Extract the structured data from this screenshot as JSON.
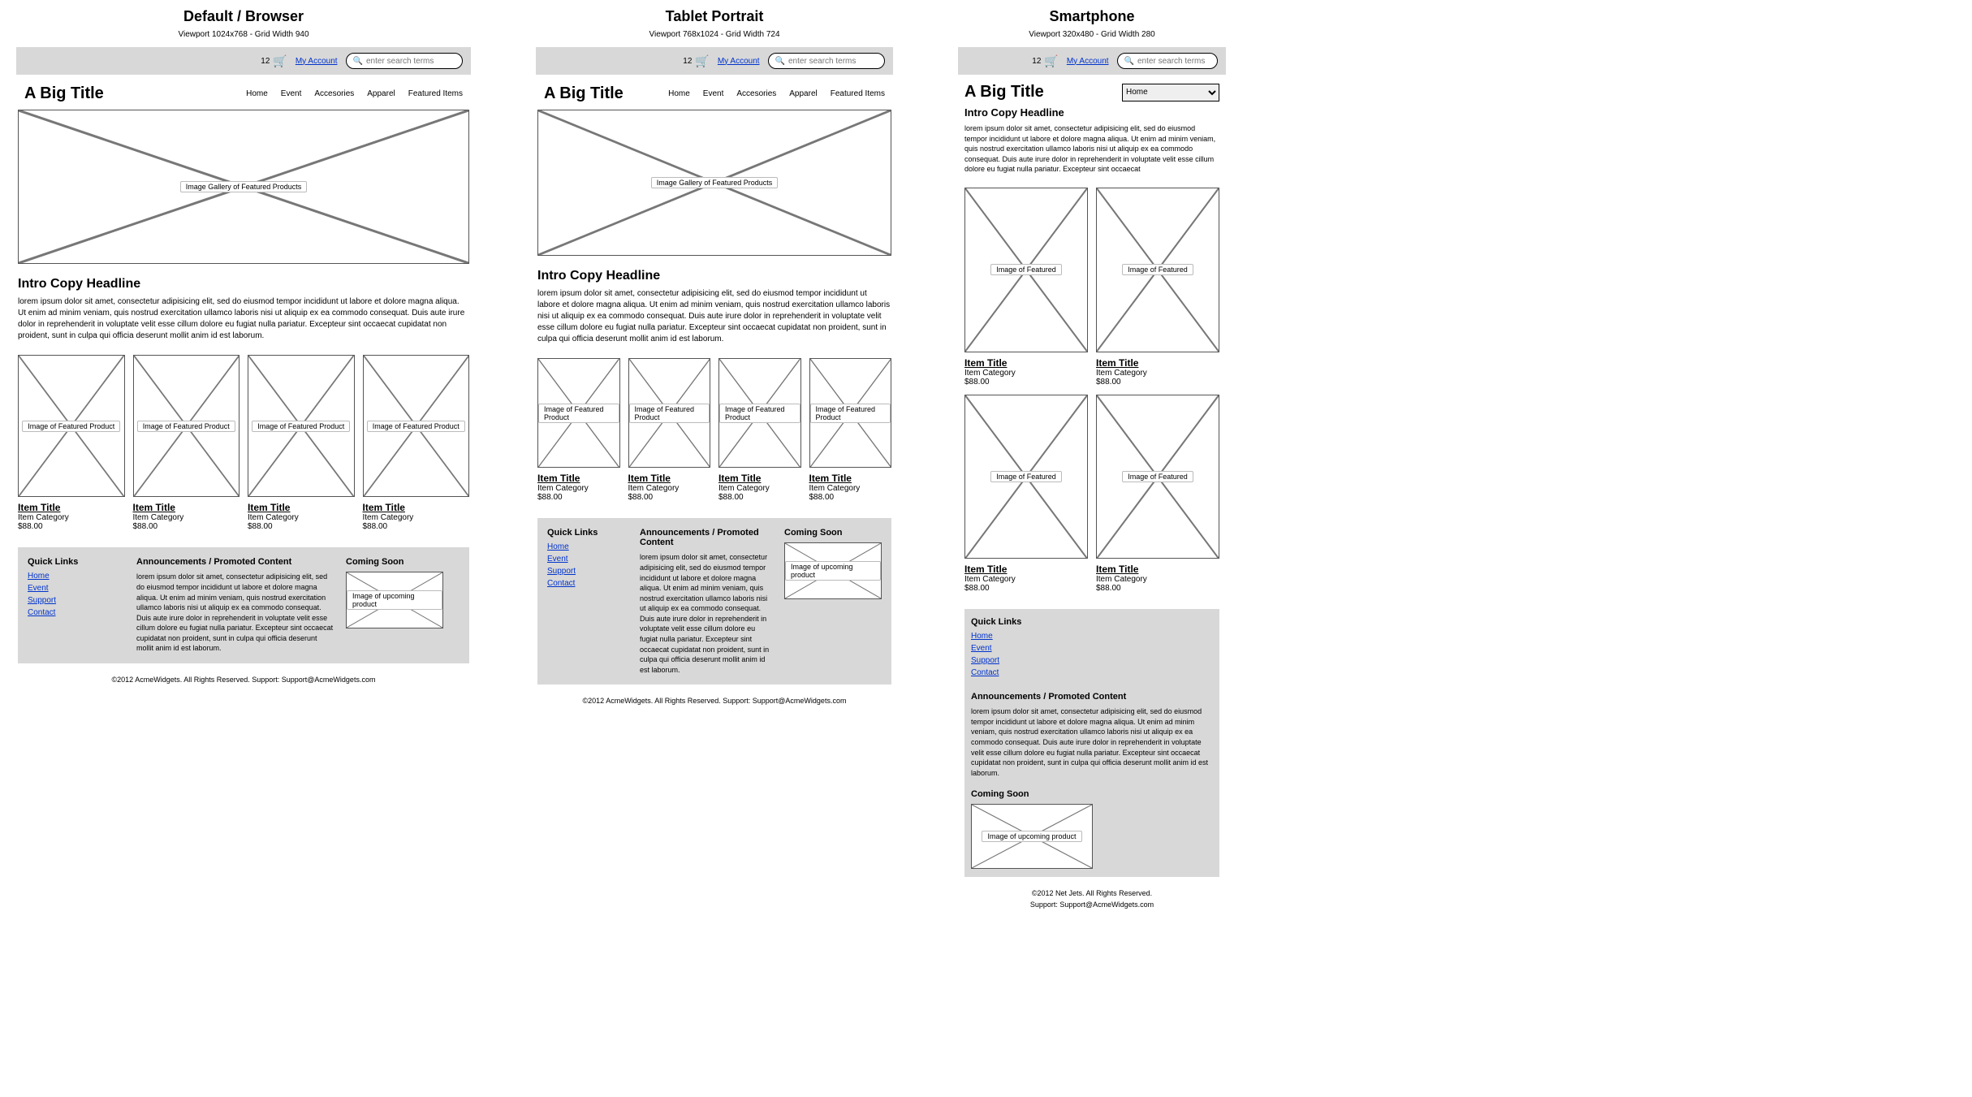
{
  "layouts": {
    "desktop": {
      "title": "Default / Browser",
      "viewport": "Viewport 1024x768 - Grid Width 940"
    },
    "tablet": {
      "title": "Tablet Portrait",
      "viewport": "Viewport 768x1024 - Grid Width 724"
    },
    "smartphone": {
      "title": "Smartphone",
      "viewport": "Viewport 320x480 - Grid Width 280"
    }
  },
  "topbar": {
    "cart_count": "12",
    "account_label": "My Account",
    "search_placeholder": "enter search terms"
  },
  "header": {
    "big_title": "A Big Title",
    "nav": [
      "Home",
      "Event",
      "Accesories",
      "Apparel",
      "Featured Items"
    ],
    "nav_selected": "Home"
  },
  "hero": {
    "label": "Image Gallery of Featured Products"
  },
  "intro": {
    "headline": "Intro Copy Headline",
    "copy_long": "lorem ipsum dolor sit amet, consectetur adipisicing elit, sed do eiusmod tempor incididunt ut labore et dolore magna aliqua. Ut enim ad minim veniam, quis nostrud exercitation ullamco laboris nisi ut aliquip ex ea commodo consequat. Duis aute irure dolor in reprehenderit in voluptate velit esse cillum dolore eu fugiat nulla pariatur. Excepteur sint occaecat cupidatat non proident, sunt in culpa qui officia deserunt mollit anim id est laborum.",
    "copy_short": "lorem ipsum dolor sit amet, consectetur adipisicing elit, sed do eiusmod tempor incididunt ut labore et dolore magna aliqua. Ut enim ad minim veniam, quis nostrud exercitation ullamco laboris nisi ut aliquip ex ea commodo consequat. Duis aute irure dolor in reprehenderit in voluptate velit esse cillum dolore eu fugiat nulla pariatur. Excepteur sint occaecat"
  },
  "product": {
    "img_label": "Image of Featured Product",
    "img_label_short": "Image of Featured",
    "title": "Item Title",
    "category": "Item Category",
    "price": "$88.00"
  },
  "footer": {
    "quicklinks_title": "Quick Links",
    "quicklinks": [
      "Home",
      "Event",
      "Support",
      "Contact"
    ],
    "announce_title": "Announcements / Promoted Content",
    "announce_copy": "lorem ipsum dolor sit amet, consectetur adipisicing elit, sed do eiusmod tempor incididunt ut labore et dolore magna aliqua. Ut enim ad minim veniam, quis nostrud exercitation ullamco laboris nisi ut aliquip ex ea commodo consequat. Duis aute irure dolor in reprehenderit in voluptate velit esse cillum dolore eu fugiat nulla pariatur. Excepteur sint occaecat cupidatat non proident, sunt in culpa qui officia deserunt mollit anim id est laborum.",
    "coming_title": "Coming Soon",
    "coming_label": "Image of upcoming product"
  },
  "copyright": {
    "desktop": "©2012 AcmeWidgets.   All Rights Reserved.   Support: Support@AcmeWidgets.com",
    "tablet": "©2012 AcmeWidgets.   All Rights Reserved.   Support: Support@AcmeWidgets.com",
    "phone_l1": "©2012 Net Jets.   All Rights Reserved.",
    "phone_l2": "Support: Support@AcmeWidgets.com"
  }
}
